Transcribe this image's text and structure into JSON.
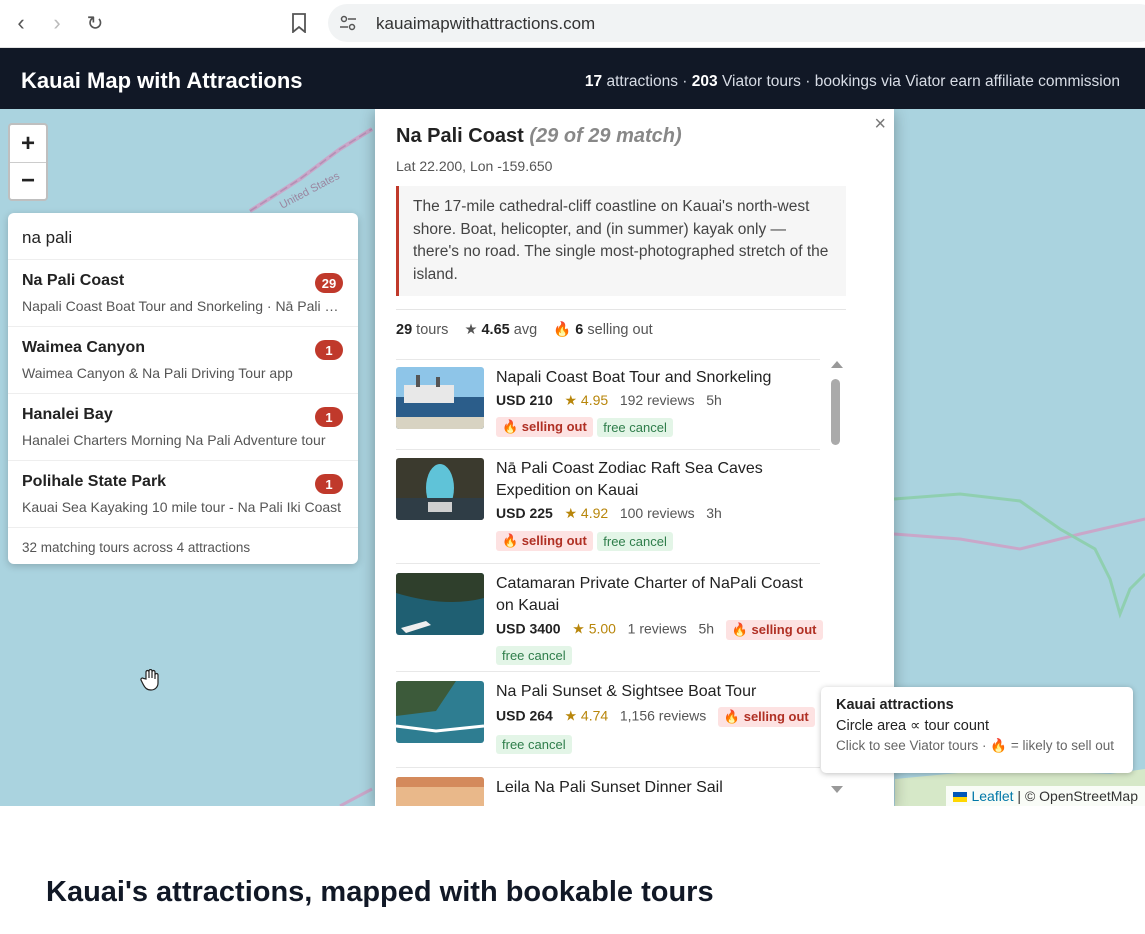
{
  "browser": {
    "url": "kauaimapwithattractions.com"
  },
  "header": {
    "title": "Kauai Map with Attractions",
    "stats_attractions_count": "17",
    "stats_attractions_label": "attractions",
    "stats_tours_count": "203",
    "stats_tours_label": "Viator tours",
    "stats_note": "bookings via Viator earn affiliate commission"
  },
  "map": {
    "label_united_states": "United States",
    "zoom_in": "+",
    "zoom_out": "−"
  },
  "search": {
    "query": "na pali",
    "results": [
      {
        "name": "Na Pali Coast",
        "sub": "Napali Coast Boat Tour and Snorkeling · Nā Pali Coast Zodiac Raft Sea Caves",
        "count": "29"
      },
      {
        "name": "Waimea Canyon",
        "sub": "Waimea Canyon & Na Pali Driving Tour app",
        "count": "1"
      },
      {
        "name": "Hanalei Bay",
        "sub": "Hanalei Charters Morning Na Pali Adventure tour",
        "count": "1"
      },
      {
        "name": "Polihale State Park",
        "sub": "Kauai Sea Kayaking 10 mile tour - Na Pali Iki Coast",
        "count": "1"
      }
    ],
    "footer": "32 matching tours across 4 attractions"
  },
  "popup": {
    "title": "Na Pali Coast",
    "match": "(29 of 29 match)",
    "coords": "Lat 22.200, Lon -159.650",
    "description": "The 17-mile cathedral-cliff coastline on Kauai's north-west shore. Boat, helicopter, and (in summer) kayak only — there's no road. The single most-photographed stretch of the island.",
    "stats": {
      "tours_count": "29",
      "tours_label": "tours",
      "avg_value": "4.65",
      "avg_label": "avg",
      "selling_count": "6",
      "selling_label": "selling out"
    },
    "close": "×",
    "tours": [
      {
        "title": "Napali Coast Boat Tour and Snorkeling",
        "price": "USD 210",
        "rating": "★ 4.95",
        "reviews": "192 reviews",
        "duration": "5h",
        "selling": "🔥 selling out",
        "free": "free cancel"
      },
      {
        "title": "Nā Pali Coast Zodiac Raft Sea Caves Expedition on Kauai",
        "price": "USD 225",
        "rating": "★ 4.92",
        "reviews": "100 reviews",
        "duration": "3h",
        "selling": "🔥 selling out",
        "free": "free cancel"
      },
      {
        "title": "Catamaran Private Charter of NaPali Coast on Kauai",
        "price": "USD 3400",
        "rating": "★ 5.00",
        "reviews": "1 reviews",
        "duration": "5h",
        "selling": "🔥 selling out",
        "free": "free cancel"
      },
      {
        "title": "Na Pali Sunset & Sightsee Boat Tour",
        "price": "USD 264",
        "rating": "★ 4.74",
        "reviews": "1,156 reviews",
        "duration": "",
        "selling": "🔥 selling out",
        "free": "free cancel"
      },
      {
        "title": "Leila Na Pali Sunset Dinner Sail"
      }
    ]
  },
  "legend": {
    "title": "Kauai attractions",
    "line1": "Circle area ∝ tour count",
    "line2": "Click to see Viator tours · 🔥 = likely to sell out"
  },
  "attribution": {
    "leaflet": "Leaflet",
    "osm": "| © OpenStreetMap"
  },
  "page": {
    "section_heading": "Kauai's attractions, mapped with bookable tours"
  },
  "colors": {
    "header_bg": "#111826",
    "water": "#aad3df",
    "accent_red": "#c0392b"
  }
}
